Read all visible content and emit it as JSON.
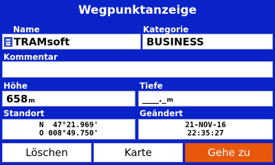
{
  "header": {
    "title": "Wegpunktanzeige"
  },
  "name": {
    "label": "Name",
    "value": "TRAMsoft",
    "icon": "waypoint-flag-icon"
  },
  "category": {
    "label": "Kategorie",
    "value": "BUSINESS"
  },
  "comment": {
    "label": "Kommentar",
    "value": ""
  },
  "altitude": {
    "label": "Höhe",
    "value": "658",
    "unit": "m"
  },
  "depth": {
    "label": "Tiefe",
    "value": "____._",
    "unit": "m"
  },
  "location": {
    "label": "Standort",
    "lat": "N  47°21.969'",
    "lon": "O 008°49.750'"
  },
  "modified": {
    "label": "Geändert",
    "date": "21-NOV-16",
    "time": "22:35:27"
  },
  "buttons": {
    "delete": "Löschen",
    "map": "Karte",
    "goto": "Gehe zu"
  },
  "colors": {
    "background": "#0a23c8",
    "accent": "#e8580c"
  }
}
